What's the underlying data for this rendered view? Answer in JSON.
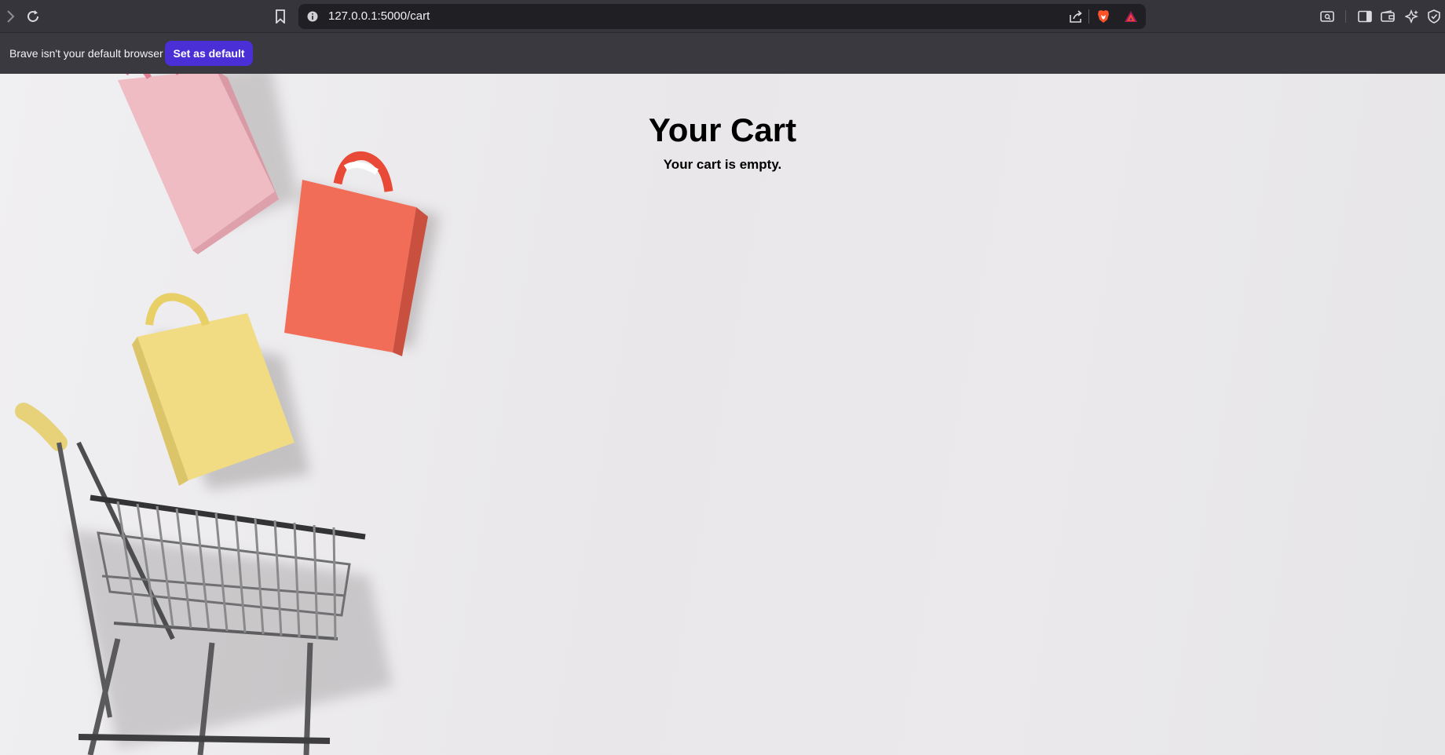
{
  "browser": {
    "url": "127.0.0.1:5000/cart",
    "notification": {
      "text": "Brave isn't your default browser",
      "button_label": "Set as default"
    },
    "icons": {
      "forward": "chevron-right-icon",
      "reload": "reload-icon",
      "bookmark": "bookmark-icon",
      "site_info": "info-icon",
      "share": "share-icon",
      "brave_shields": "brave-lion-icon",
      "brave_rewards": "rewards-triangle-icon",
      "screenshot": "tab-search-icon",
      "sidebar": "sidebar-icon",
      "wallet": "wallet-icon",
      "leo": "leo-ai-icon",
      "vpn": "vpn-shield-icon"
    },
    "colors": {
      "accent_button": "#4b2fd6",
      "toolbar": "#35353b"
    }
  },
  "page": {
    "title": "Your Cart",
    "empty_message": "Your cart is empty."
  }
}
